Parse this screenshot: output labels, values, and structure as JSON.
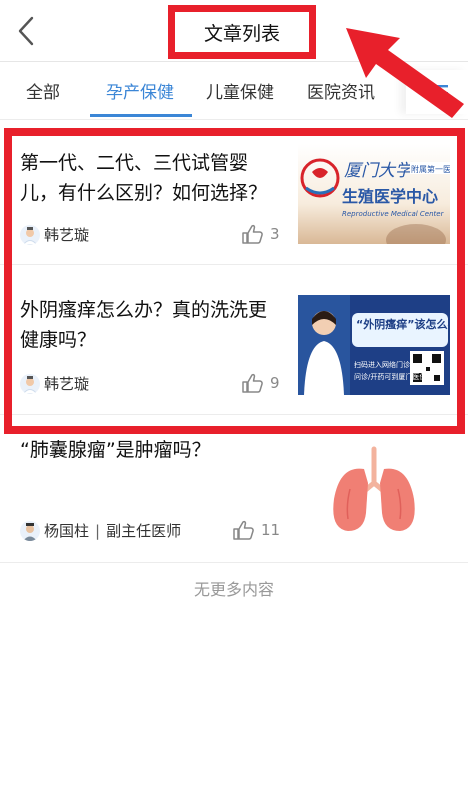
{
  "header": {
    "title": "文章列表"
  },
  "tabs": [
    {
      "label": "全部"
    },
    {
      "label": "孕产保健"
    },
    {
      "label": "儿童保健"
    },
    {
      "label": "医院资讯"
    }
  ],
  "articles": [
    {
      "title_line1": "第一代、二代、三代试管婴",
      "title_line2": "儿，有什么区别？如何选择？",
      "author": "韩艺璇",
      "likes": "3",
      "thumb": {
        "logo_text": "厦门大学",
        "badge": "附属第一医院",
        "center": "生殖医学中心",
        "english": "Reproductive Medical Center"
      }
    },
    {
      "title_line1": "外阴瘙痒怎么办？真的洗洗更",
      "title_line2": "健康吗？",
      "author": "韩艺璇",
      "likes": "9",
      "thumb": {
        "headline": "“外阴瘙痒”该怎么办？",
        "scan_line1": "扫码进入网络门诊",
        "scan_line2": "问诊/开药可到厦门医保"
      }
    },
    {
      "title_line1": "“肺囊腺瘤”是肿瘤吗？",
      "author": "杨国柱",
      "author_role": "副主任医师",
      "likes": "11"
    }
  ],
  "footer": {
    "no_more": "无更多内容"
  },
  "colors": {
    "accent": "#3b86d6",
    "annotation_red": "#e8202b"
  }
}
